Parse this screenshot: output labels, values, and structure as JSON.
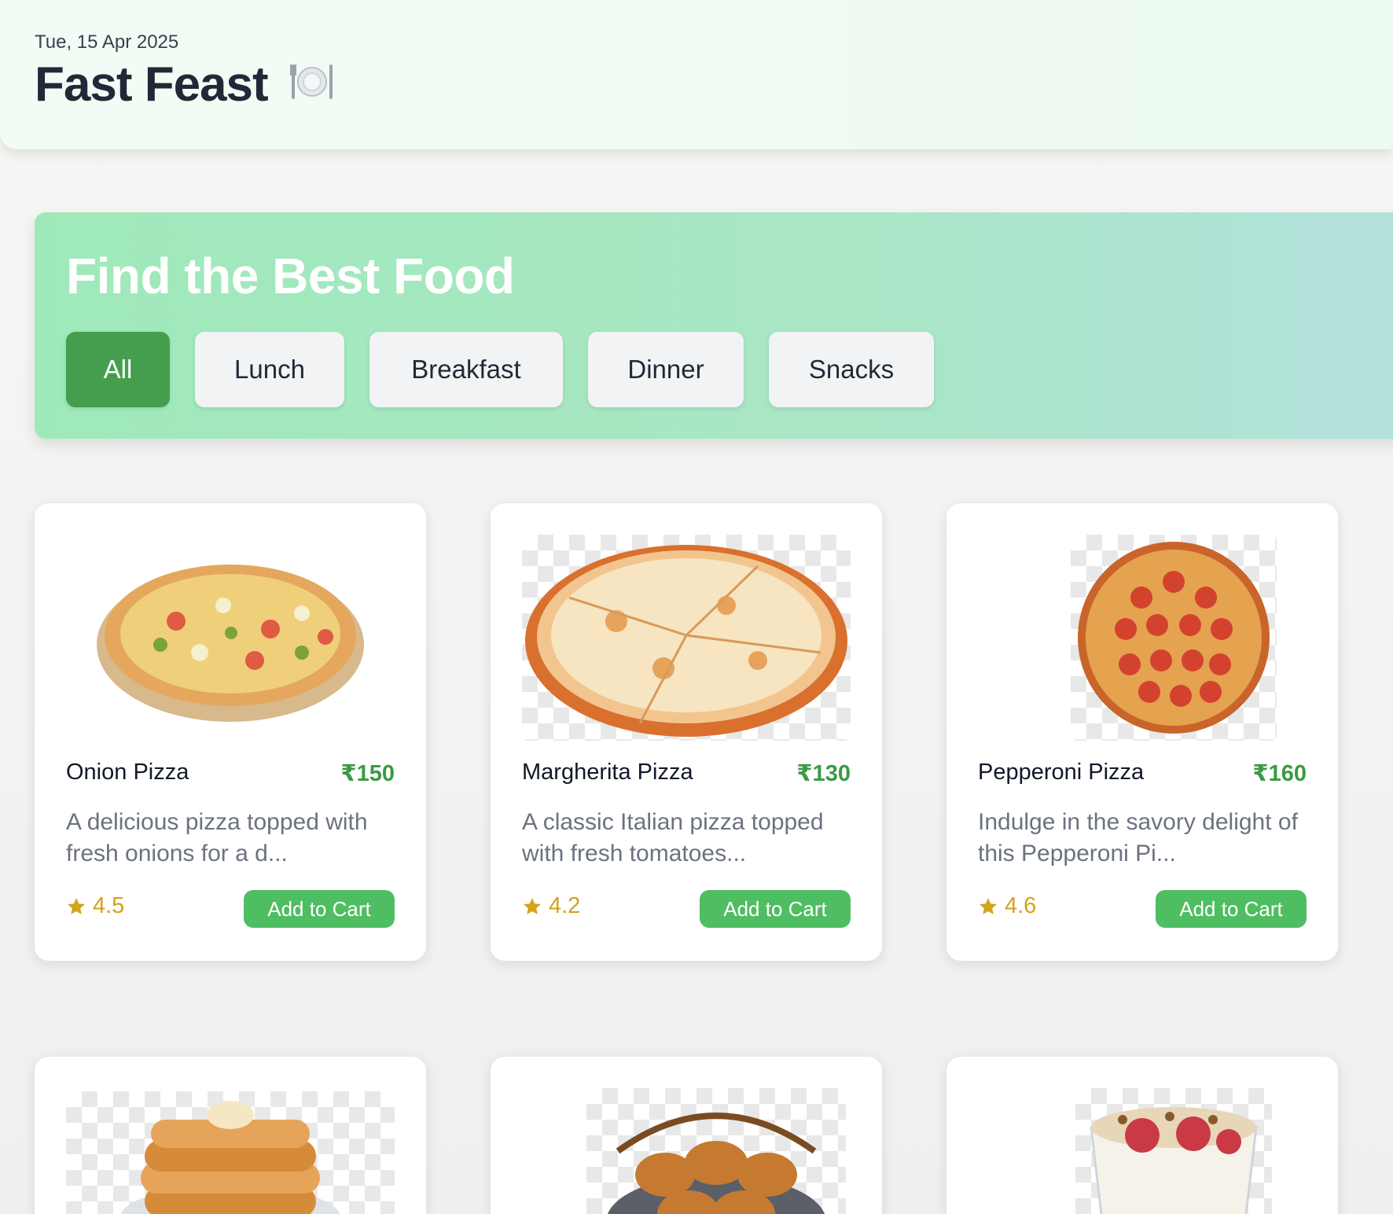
{
  "header": {
    "date": "Tue, 15 Apr 2025",
    "title": "Fast Feast"
  },
  "hero": {
    "title": "Find the Best Food",
    "filters": [
      {
        "label": "All",
        "active": true
      },
      {
        "label": "Lunch",
        "active": false
      },
      {
        "label": "Breakfast",
        "active": false
      },
      {
        "label": "Dinner",
        "active": false
      },
      {
        "label": "Snacks",
        "active": false
      }
    ]
  },
  "cards": [
    {
      "name": "Onion Pizza",
      "price": "₹150",
      "description": "A delicious pizza topped with fresh onions for a d...",
      "rating": "4.5",
      "cta": "Add to Cart"
    },
    {
      "name": "Margherita Pizza",
      "price": "₹130",
      "description": "A classic Italian pizza topped with fresh tomatoes...",
      "rating": "4.2",
      "cta": "Add to Cart"
    },
    {
      "name": "Pepperoni Pizza",
      "price": "₹160",
      "description": "Indulge in the savory delight of this Pepperoni Pi...",
      "rating": "4.6",
      "cta": "Add to Cart"
    }
  ],
  "colors": {
    "accent_green": "#459e4e",
    "button_green": "#4fbd62",
    "price_green": "#3a9a45",
    "rating_gold": "#d4a21b"
  },
  "icons": [
    "plate-cutlery-icon",
    "star-icon"
  ]
}
